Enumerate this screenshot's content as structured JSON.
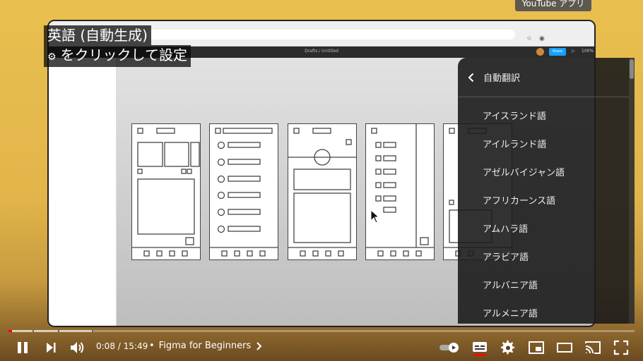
{
  "tooltip": "YouTube アプリ",
  "recorded_screen": {
    "figma_title": "Drafts / Untitled",
    "share_label": "Share",
    "zoom_label": "100%"
  },
  "caption": {
    "line1": "英語 (自動生成)",
    "line2": "をクリックして設定"
  },
  "menu": {
    "title": "自動翻訳",
    "items": [
      "アイスランド語",
      "アイルランド語",
      "アゼルバイジャン語",
      "アフリカーンス語",
      "アムハラ語",
      "アラビア語",
      "アルバニア語",
      "アルメニア語"
    ]
  },
  "player": {
    "current_time": "0:08",
    "duration": "15:49",
    "time_separator": " / ",
    "chapter": "Figma for Beginners",
    "progress_fraction": 0.006,
    "buffer_fraction": 0.135,
    "played_color": "#ff0000"
  },
  "icons": {
    "play_pause": "pause-icon",
    "next": "next-icon",
    "volume": "volume-icon",
    "autoplay": "autoplay-toggle-icon",
    "subtitles": "subtitles-icon",
    "settings": "gear-icon",
    "miniplayer": "miniplayer-icon",
    "theater": "theater-icon",
    "cast": "cast-icon",
    "fullscreen": "fullscreen-icon"
  }
}
